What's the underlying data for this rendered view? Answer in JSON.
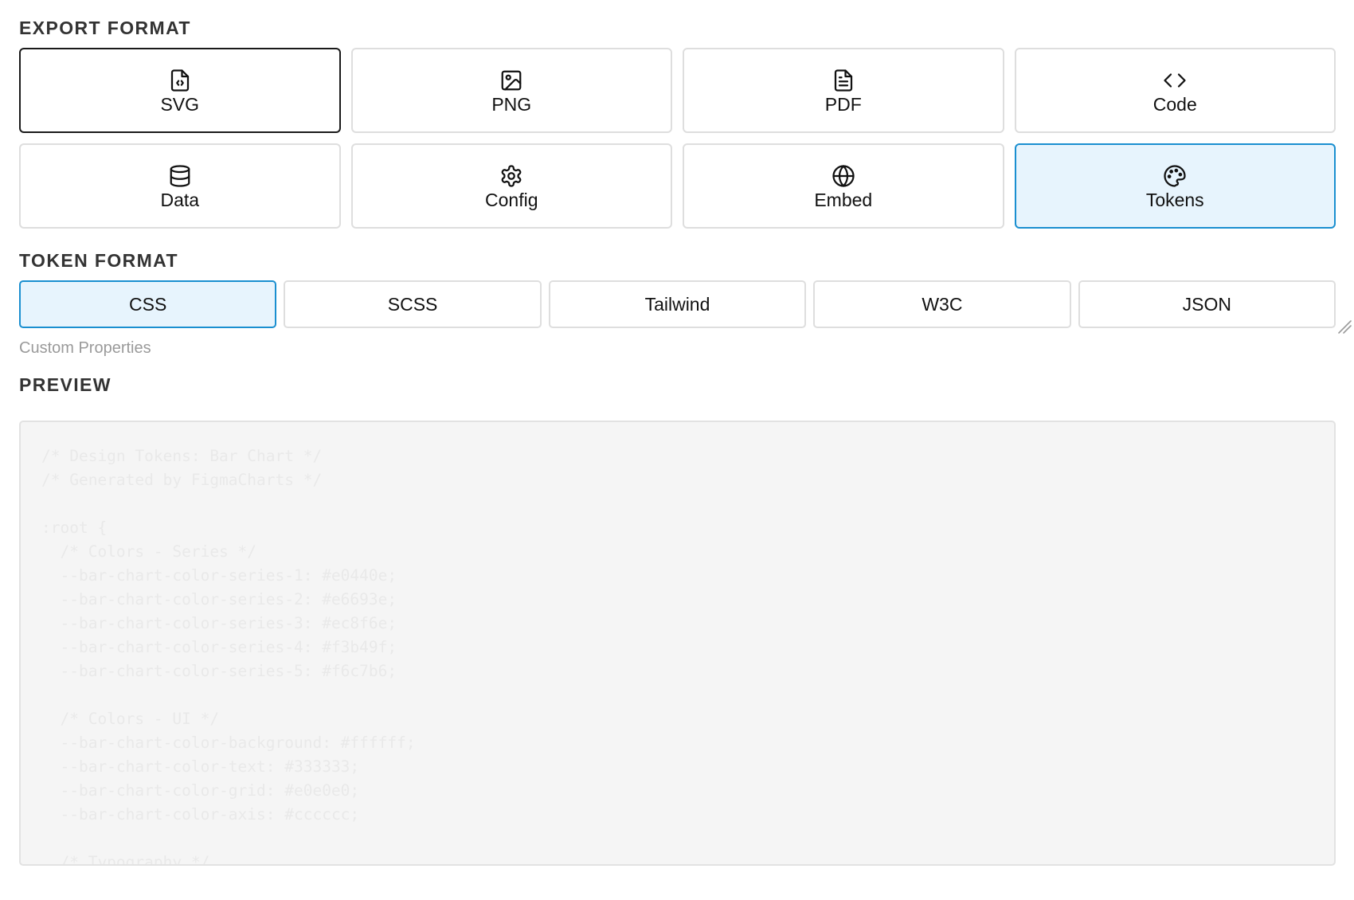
{
  "export_format": {
    "title": "EXPORT FORMAT",
    "options": [
      {
        "label": "SVG",
        "icon": "file-code-icon"
      },
      {
        "label": "PNG",
        "icon": "image-icon"
      },
      {
        "label": "PDF",
        "icon": "file-text-icon"
      },
      {
        "label": "Code",
        "icon": "code-icon"
      },
      {
        "label": "Data",
        "icon": "database-icon"
      },
      {
        "label": "Config",
        "icon": "gear-icon"
      },
      {
        "label": "Embed",
        "icon": "globe-icon"
      },
      {
        "label": "Tokens",
        "icon": "palette-icon"
      }
    ],
    "primary_selected": "SVG",
    "active": "Tokens"
  },
  "token_format": {
    "title": "TOKEN FORMAT",
    "options": [
      "CSS",
      "SCSS",
      "Tailwind",
      "W3C",
      "JSON"
    ],
    "selected": "CSS",
    "description": "Custom Properties"
  },
  "preview": {
    "title": "PREVIEW",
    "code": "/* Design Tokens: Bar Chart */\n/* Generated by FigmaCharts */\n\n:root {\n  /* Colors - Series */\n  --bar-chart-color-series-1: #e0440e;\n  --bar-chart-color-series-2: #e6693e;\n  --bar-chart-color-series-3: #ec8f6e;\n  --bar-chart-color-series-4: #f3b49f;\n  --bar-chart-color-series-5: #f6c7b6;\n\n  /* Colors - UI */\n  --bar-chart-color-background: #ffffff;\n  --bar-chart-color-text: #333333;\n  --bar-chart-color-grid: #e0e0e0;\n  --bar-chart-color-axis: #cccccc;\n\n  /* Typography */"
  },
  "colors": {
    "accent": "#1a8fd0",
    "accent_bg": "#e7f4fd",
    "border": "#dedede",
    "primary_border": "#1a1a1a"
  }
}
